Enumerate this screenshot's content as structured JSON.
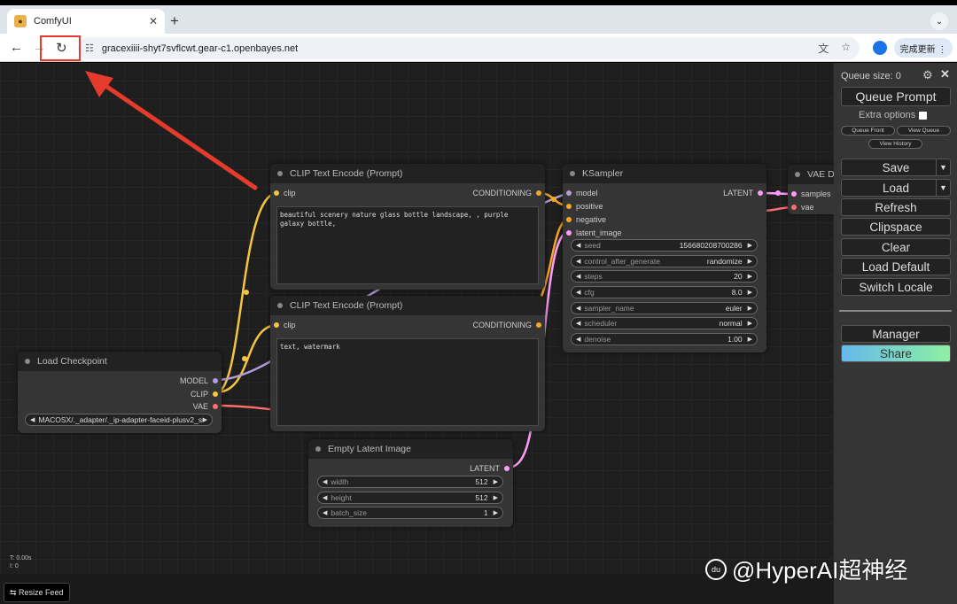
{
  "browser": {
    "tab_title": "ComfyUI",
    "tab_close": "✕",
    "new_tab": "+",
    "tab_menu": "⌄",
    "back": "←",
    "forward": "→",
    "reload": "↻",
    "url": "gracexiiii-shyt7svflcwt.gear-c1.openbayes.net",
    "translate_icon": "文",
    "star_icon": "☆",
    "update_button": "完成更新 ⋮"
  },
  "canvas": {
    "stats": [
      "T: 0.00s",
      "I: 0",
      "N: 7 [7]"
    ],
    "resize_feed": "⇆ Resize Feed"
  },
  "nodes": {
    "clip_top": {
      "title": "CLIP Text Encode (Prompt)",
      "input": "clip",
      "output": "CONDITIONING",
      "text": "beautiful scenery nature glass bottle landscape, , purple galaxy bottle,"
    },
    "clip_bottom": {
      "title": "CLIP Text Encode (Prompt)",
      "input": "clip",
      "output": "CONDITIONING",
      "text": "text, watermark"
    },
    "ksampler": {
      "title": "KSampler",
      "inputs": [
        "model",
        "positive",
        "negative",
        "latent_image"
      ],
      "output": "LATENT",
      "widgets": [
        {
          "label": "seed",
          "value": "156680208700286"
        },
        {
          "label": "control_after_generate",
          "value": "randomize"
        },
        {
          "label": "steps",
          "value": "20"
        },
        {
          "label": "cfg",
          "value": "8.0"
        },
        {
          "label": "sampler_name",
          "value": "euler"
        },
        {
          "label": "scheduler",
          "value": "normal"
        },
        {
          "label": "denoise",
          "value": "1.00"
        }
      ]
    },
    "vae": {
      "title": "VAE D",
      "inputs": [
        "samples",
        "vae"
      ]
    },
    "checkpoint": {
      "title": "Load Checkpoint",
      "outputs": [
        "MODEL",
        "CLIP",
        "VAE"
      ],
      "widget_value": "MACOSX/._adapter/._ip-adapter-faceid-plusv2_sdxl.bin"
    },
    "latent": {
      "title": "Empty Latent Image",
      "output": "LATENT",
      "widgets": [
        {
          "label": "width",
          "value": "512"
        },
        {
          "label": "height",
          "value": "512"
        },
        {
          "label": "batch_size",
          "value": "1"
        }
      ]
    }
  },
  "sidemenu": {
    "queue_size": "Queue size: 0",
    "queue_prompt": "Queue Prompt",
    "extra_options": "Extra options",
    "queue_front": "Queue Front",
    "view_queue": "View Queue",
    "view_history": "View History",
    "buttons": [
      "Save",
      "Load",
      "Refresh",
      "Clipspace",
      "Clear",
      "Load Default",
      "Switch Locale"
    ],
    "manager": "Manager",
    "share": "Share"
  },
  "watermark": "@HyperAI超神经",
  "colors": {
    "clip": "#f5c542",
    "model": "#b39ddb",
    "conditioning": "#f5a623",
    "latent": "#ff9cf9",
    "vae": "#ff6e6e",
    "annotation": "#e53b2c"
  }
}
